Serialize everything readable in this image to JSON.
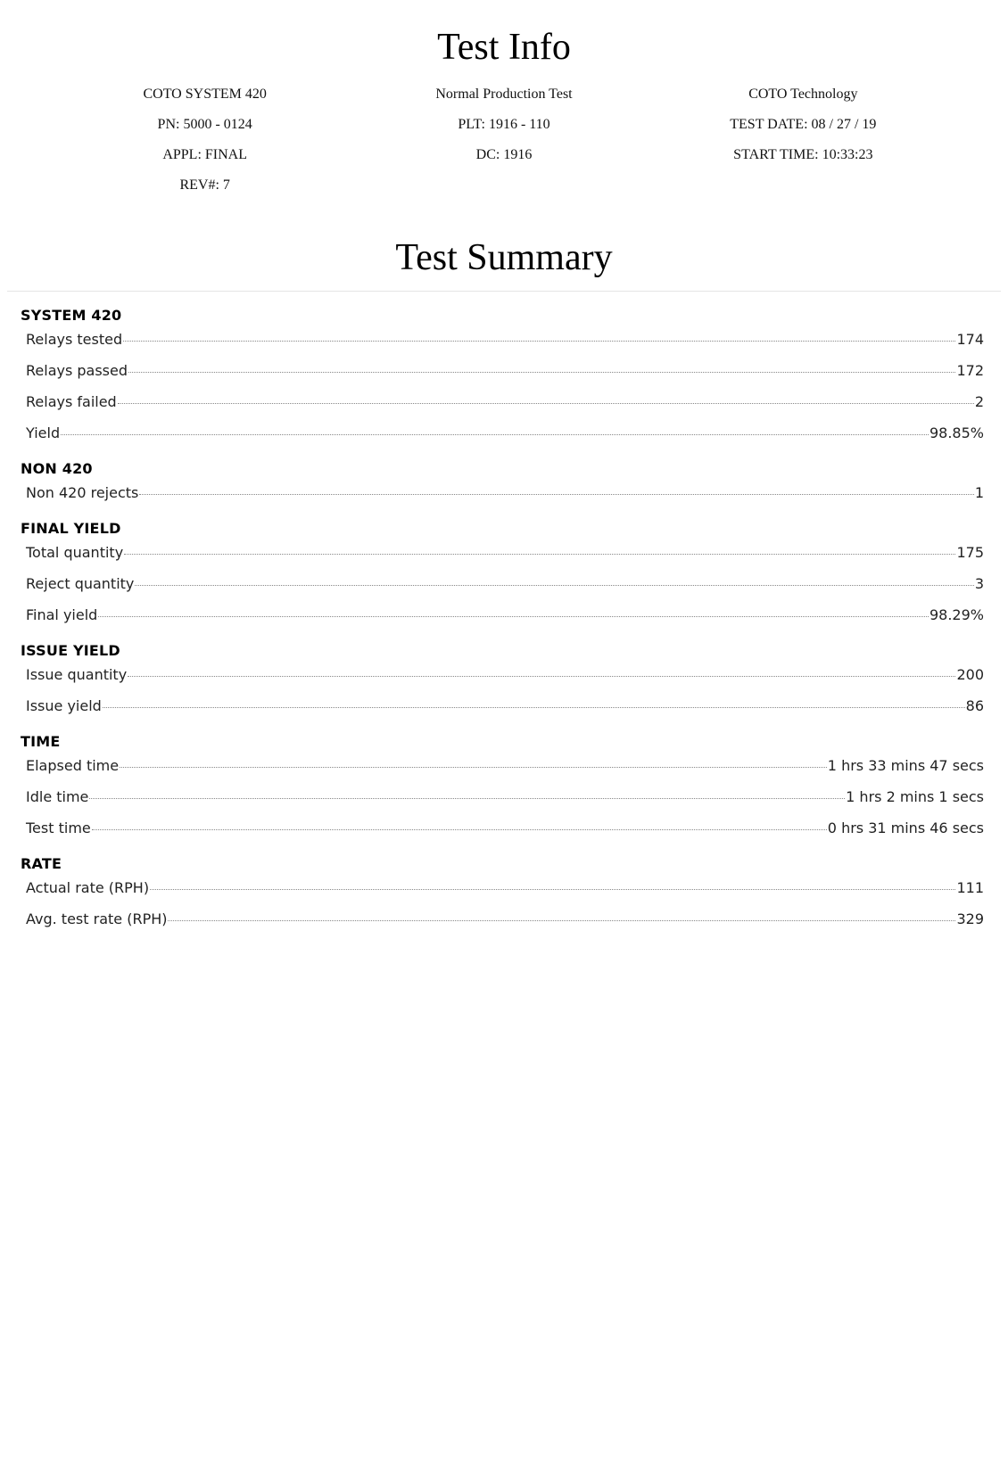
{
  "test_info": {
    "title": "Test Info",
    "columns": [
      [
        "COTO SYSTEM 420",
        "PN: 5000 - 0124",
        "APPL: FINAL",
        "REV#: 7"
      ],
      [
        "Normal Production Test",
        "PLT: 1916 - 110",
        "DC: 1916"
      ],
      [
        "COTO Technology",
        "TEST DATE: 08 / 27 / 19",
        "START TIME: 10:33:23"
      ]
    ]
  },
  "test_summary": {
    "title": "Test Summary",
    "sections": [
      {
        "heading": "SYSTEM 420",
        "rows": [
          {
            "label": "Relays tested",
            "value": "174"
          },
          {
            "label": "Relays passed",
            "value": "172"
          },
          {
            "label": "Relays failed",
            "value": "2"
          },
          {
            "label": "Yield",
            "value": "98.85%"
          }
        ]
      },
      {
        "heading": "NON 420",
        "rows": [
          {
            "label": "Non 420 rejects",
            "value": "1"
          }
        ]
      },
      {
        "heading": "FINAL YIELD",
        "rows": [
          {
            "label": "Total quantity",
            "value": "175"
          },
          {
            "label": "Reject quantity",
            "value": "3"
          },
          {
            "label": "Final yield",
            "value": "98.29%"
          }
        ]
      },
      {
        "heading": "ISSUE YIELD",
        "rows": [
          {
            "label": "Issue quantity",
            "value": "200"
          },
          {
            "label": "Issue yield",
            "value": "86"
          }
        ]
      },
      {
        "heading": "TIME",
        "rows": [
          {
            "label": "Elapsed time",
            "value": "1 hrs 33 mins 47 secs"
          },
          {
            "label": "Idle time",
            "value": "1 hrs 2 mins 1 secs"
          },
          {
            "label": "Test time",
            "value": "0 hrs 31 mins 46 secs"
          }
        ]
      },
      {
        "heading": "RATE",
        "rows": [
          {
            "label": "Actual rate (RPH)",
            "value": "111"
          },
          {
            "label": "Avg. test rate (RPH)",
            "value": "329"
          }
        ]
      }
    ]
  }
}
